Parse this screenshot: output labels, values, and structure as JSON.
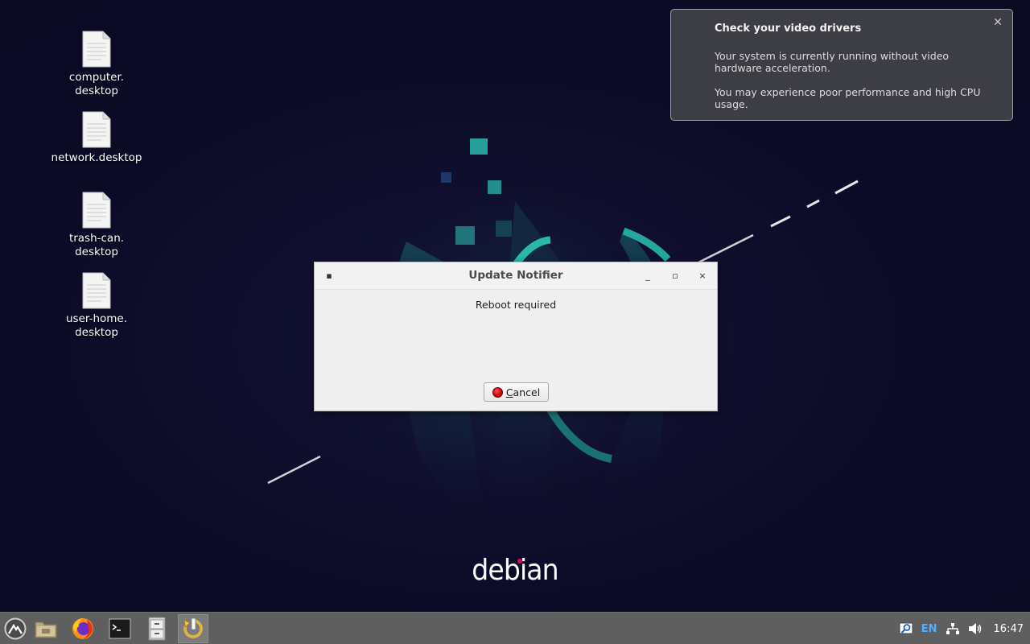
{
  "desktop": {
    "icons": [
      {
        "label": "computer.\ndesktop"
      },
      {
        "label": "network.desktop"
      },
      {
        "label": "trash-can.\ndesktop"
      },
      {
        "label": "user-home.\ndesktop"
      }
    ],
    "wallpaper_brand": "debian",
    "wallpaper_accent": "#2ab8ad",
    "background": "#0d0c2a"
  },
  "notification": {
    "title": "Check your video drivers",
    "body1": "Your system is currently running without video hardware acceleration.",
    "body2": "You may experience poor performance and high CPU usage.",
    "close_icon": "close-icon"
  },
  "dialog": {
    "title": "Update Notifier",
    "message": "Reboot required",
    "cancel_label": "ancel",
    "cancel_mnemonic": "C",
    "menu_glyph": "▪",
    "minimize_glyph": "_",
    "maximize_glyph": "▫",
    "close_glyph": "×"
  },
  "taskbar": {
    "launchers": [
      "app-menu-icon",
      "file-manager-icon",
      "firefox-icon",
      "terminal-icon",
      "file-cabinet-icon",
      "update-notifier-icon"
    ],
    "tray": {
      "language": "EN",
      "clock": "16:47"
    }
  }
}
